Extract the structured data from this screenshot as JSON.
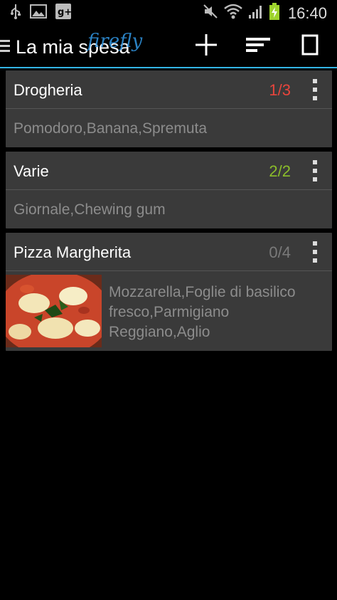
{
  "status_bar": {
    "time": "16:40",
    "icons": [
      "usb-icon",
      "image-icon",
      "google-plus-icon",
      "mute-icon",
      "wifi-icon",
      "signal-icon",
      "battery-charging-icon"
    ]
  },
  "action_bar": {
    "title": "La mia spesa",
    "brand": "firefly",
    "buttons": [
      "add-icon",
      "sort-icon",
      "view-mode-icon"
    ]
  },
  "colors": {
    "accent": "#33b5e5",
    "count_partial": "#e8453c",
    "count_complete": "#8bbd2a",
    "count_none": "#7a7a7a"
  },
  "lists": [
    {
      "name": "Drogheria",
      "count": "1/3",
      "status": "partial",
      "items": "Pomodoro,Banana,Spremuta"
    },
    {
      "name": "Varie",
      "count": "2/2",
      "status": "complete",
      "items": "Giornale,Chewing gum"
    },
    {
      "name": "Pizza Margherita",
      "count": "0/4",
      "status": "none",
      "items": "Mozzarella,Foglie di basilico fresco,Parmigiano Reggiano,Aglio"
    }
  ]
}
